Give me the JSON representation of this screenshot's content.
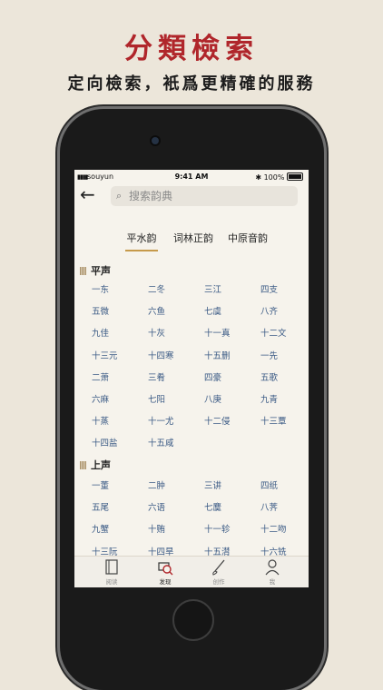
{
  "promo": {
    "title": "分類檢索",
    "subtitle": "定向檢索，衹爲更精確的服務"
  },
  "status_bar": {
    "carrier": "souyun",
    "time": "9:41 AM",
    "battery": "100%"
  },
  "search": {
    "placeholder": "搜索韵典"
  },
  "tabs": [
    {
      "label": "平水韵",
      "active": true
    },
    {
      "label": "词林正韵",
      "active": false
    },
    {
      "label": "中原音韵",
      "active": false
    }
  ],
  "sections": [
    {
      "title": "平声",
      "items": [
        "一东",
        "二冬",
        "三江",
        "四支",
        "五微",
        "六鱼",
        "七虞",
        "八齐",
        "九佳",
        "十灰",
        "十一真",
        "十二文",
        "十三元",
        "十四寒",
        "十五删",
        "一先",
        "二萧",
        "三肴",
        "四豪",
        "五歌",
        "六麻",
        "七阳",
        "八庚",
        "九青",
        "十蒸",
        "十一尤",
        "十二侵",
        "十三覃",
        "十四盐",
        "十五咸"
      ]
    },
    {
      "title": "上声",
      "items": [
        "一董",
        "二肿",
        "三讲",
        "四纸",
        "五尾",
        "六语",
        "七麌",
        "八荠",
        "九蟹",
        "十贿",
        "十一轸",
        "十二吻",
        "十三阮",
        "十四旱",
        "十五潸",
        "十六铣"
      ]
    }
  ],
  "tabbar": [
    {
      "label": "阅读",
      "icon": "book-icon",
      "active": false
    },
    {
      "label": "发现",
      "icon": "discover-icon",
      "active": true
    },
    {
      "label": "创作",
      "icon": "brush-icon",
      "active": false
    },
    {
      "label": "我",
      "icon": "user-icon",
      "active": false
    }
  ],
  "colors": {
    "accent_red": "#b0262b",
    "link_blue": "#3a5a85",
    "tab_underline": "#c69a4b"
  }
}
